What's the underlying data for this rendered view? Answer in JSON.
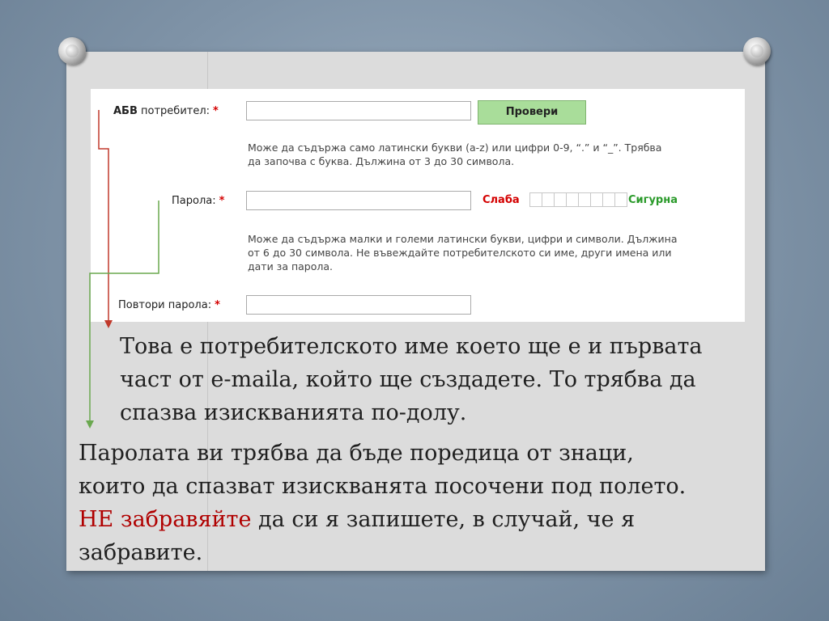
{
  "form": {
    "username_bold": "АБВ",
    "username_label": "потребител:",
    "required_mark": "*",
    "check_button": "Провери",
    "username_hint_1": "Може да съдържа само латински букви (a-z) или цифри 0-9, “.” и “_”. Трябва",
    "username_hint_2": "да започва с буква. Дължина от 3 до 30 символа.",
    "password_label": "Парола:",
    "strength_weak": "Слаба",
    "strength_strong": "Сигурна",
    "strength_segments": 8,
    "password_hint_1": "Може да съдържа малки и големи латински букви, цифри и символи. Дължина",
    "password_hint_2": "от 6 до 30 символа. Не въвеждайте потребителското си име, други имена или",
    "password_hint_3": "дати за парола.",
    "repeat_label": "Повтори парола:"
  },
  "captions": {
    "caption1_line1": "Това е потребителското име което ще е и първата",
    "caption1_line2": "част от e-maila, който ще създадете. То трябва да",
    "caption1_line3": "спазва изискванията по-долу.",
    "caption2_line1": "Паролата ви трябва да бъде поредица от знаци,",
    "caption2_line2": "които да спазват изискванята посочени под полето.",
    "caption2_emph": "НЕ забравяйте",
    "caption2_line3_rest": " да си я запишете, в случай, че я",
    "caption2_line4": "забравите."
  },
  "colors": {
    "required": "#d40000",
    "weak": "#d40000",
    "strong": "#2a9a2a",
    "check_button": "#a9dd9a",
    "arrow_username": "#c0392b",
    "arrow_password": "#6aa84f",
    "emphasis": "#b00000"
  }
}
